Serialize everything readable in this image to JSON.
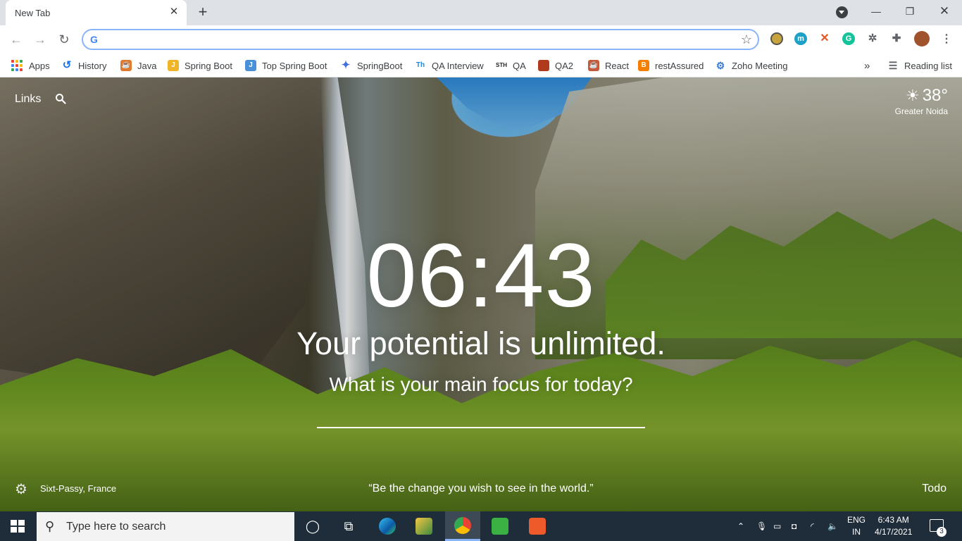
{
  "browser": {
    "tab": {
      "title": "New Tab"
    },
    "omnibox": {
      "value": "",
      "placeholder": ""
    }
  },
  "bookmarks": [
    {
      "label": "Apps",
      "icon": "apps-grid-icon"
    },
    {
      "label": "History",
      "icon": "history-icon"
    },
    {
      "label": "Java",
      "icon": "java-icon"
    },
    {
      "label": "Spring Boot",
      "icon": "spring-boot-icon"
    },
    {
      "label": "Top Spring Boot",
      "icon": "j-icon"
    },
    {
      "label": "SpringBoot",
      "icon": "springboot-icon"
    },
    {
      "label": "QA Interview",
      "icon": "qa-interview-icon"
    },
    {
      "label": "QA",
      "icon": "qa-icon"
    },
    {
      "label": "QA2",
      "icon": "qa2-icon"
    },
    {
      "label": "React",
      "icon": "react-icon"
    },
    {
      "label": "restAssured",
      "icon": "blogger-icon"
    },
    {
      "label": "Zoho Meeting",
      "icon": "zoho-icon"
    }
  ],
  "reading_list": "Reading list",
  "newtab": {
    "links_label": "Links",
    "weather": {
      "temp": "38°",
      "location": "Greater Noida"
    },
    "time": "06:43",
    "mantra": "Your potential is unlimited.",
    "focus_question": "What is your main focus for today?",
    "focus_value": "",
    "photo_location": "Sixt-Passy, France",
    "quote": "“Be the change you wish to see in the world.”",
    "todo_label": "Todo"
  },
  "taskbar": {
    "search_placeholder": "Type here to search",
    "lang_line1": "ENG",
    "lang_line2": "IN",
    "time": "6:43 AM",
    "date": "4/17/2021",
    "notification_count": "3"
  },
  "colors": {
    "omnibox_focus": "#8ab4f8",
    "taskbar": "#1f2d3a"
  }
}
